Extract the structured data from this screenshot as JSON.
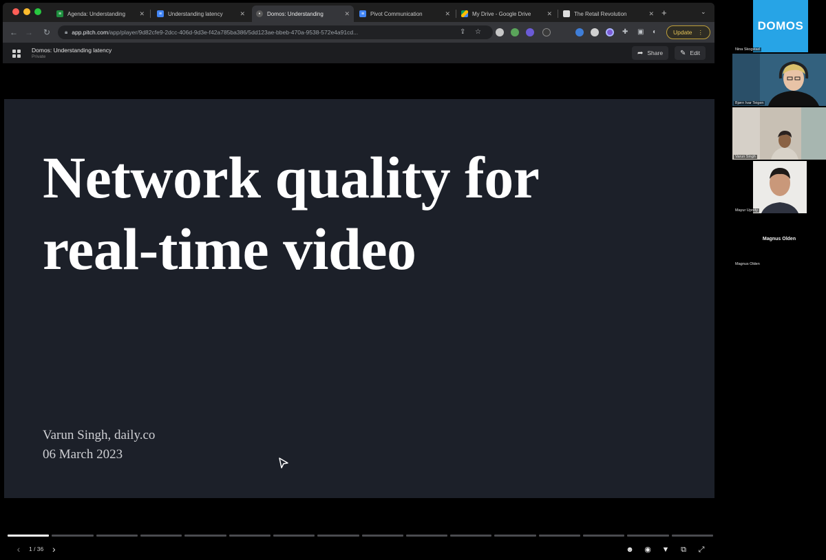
{
  "browser": {
    "tabs": [
      {
        "title": "Agenda: Understanding",
        "icon": "sheets-icon",
        "color": "#1e8e3e"
      },
      {
        "title": "Understanding latency",
        "icon": "docs-icon",
        "color": "#4285f4"
      },
      {
        "title": "Domos: Understanding",
        "icon": "pitch-icon",
        "color": "#888888",
        "active": true
      },
      {
        "title": "Pivot Communication",
        "icon": "docs-icon",
        "color": "#4285f4"
      },
      {
        "title": "My Drive - Google Drive",
        "icon": "drive-icon",
        "color": "#fbbc04"
      },
      {
        "title": "The Retail Revolution",
        "icon": "page-icon",
        "color": "#dddddd"
      }
    ],
    "url_host": "app.pitch.com",
    "url_path": "/app/player/9d82cfe9-2dcc-406d-9d3e-f42a785ba386/5dd123ae-bbeb-470a-9538-572e4a91cd...",
    "update_label": "Update"
  },
  "app": {
    "doc_title": "Domos: Understanding latency",
    "doc_subtitle": "Private",
    "share_label": "Share",
    "edit_label": "Edit"
  },
  "slide": {
    "title_line1": "Network quality for",
    "title_line2": "real-time video",
    "author": "Varun Singh, daily.co",
    "date": "06 March 2023",
    "background": "#1c2029"
  },
  "player": {
    "page_counter": "1 / 36",
    "total_segments": 16,
    "current_segment": 1
  },
  "call": {
    "logo_text": "DOMOS",
    "participants": [
      {
        "name": "Nina Skogstad"
      },
      {
        "name": "Bjørn Ivar Teigen"
      },
      {
        "name": "Varun Singh"
      },
      {
        "name": "Mayur Uprety"
      },
      {
        "name": "Magnus Olden"
      }
    ],
    "center_label": "Magnus Olden"
  }
}
